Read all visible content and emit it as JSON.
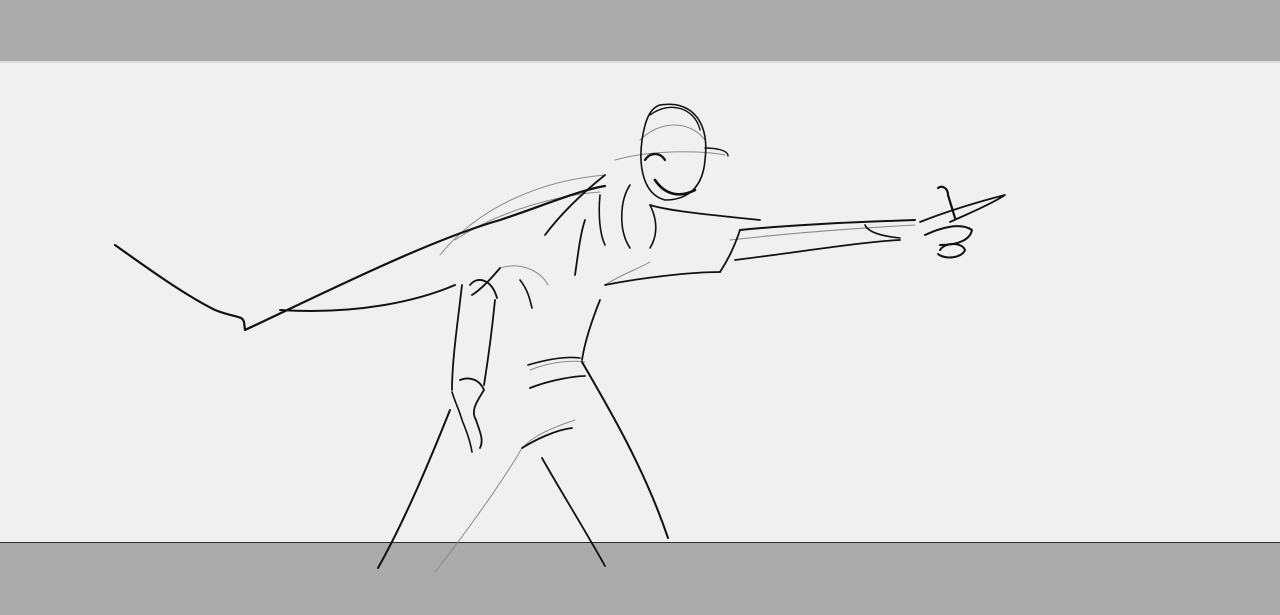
{
  "scene": {
    "subject": "figure-sketch-icon",
    "colors": {
      "letterbox": "#ababab",
      "frame": "#f0f0f0",
      "ink": "#111111",
      "light_ink": "#8a8a8a"
    }
  }
}
